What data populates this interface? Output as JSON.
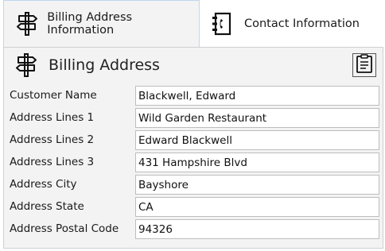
{
  "tabs": [
    {
      "label": "Billing Address Information",
      "icon": "signpost-icon",
      "active": true
    },
    {
      "label": "Contact Information",
      "icon": "address-book-icon",
      "active": false
    }
  ],
  "panel": {
    "title": "Billing Address",
    "title_icon": "signpost-icon",
    "action_icon": "clipboard-icon"
  },
  "fields": [
    {
      "label": "Customer Name",
      "value": "Blackwell, Edward"
    },
    {
      "label": "Address Lines 1",
      "value": "Wild Garden Restaurant"
    },
    {
      "label": "Address Lines 2",
      "value": "Edward Blackwell"
    },
    {
      "label": "Address Lines 3",
      "value": "431 Hampshire Blvd"
    },
    {
      "label": "Address City",
      "value": "Bayshore"
    },
    {
      "label": "Address State",
      "value": "CA"
    },
    {
      "label": "Address Postal Code",
      "value": "94326"
    }
  ],
  "colors": {
    "panel_bg": "#f3f3f3",
    "active_tab_border": "#bcd7ef",
    "field_border": "#bdbdbd"
  }
}
